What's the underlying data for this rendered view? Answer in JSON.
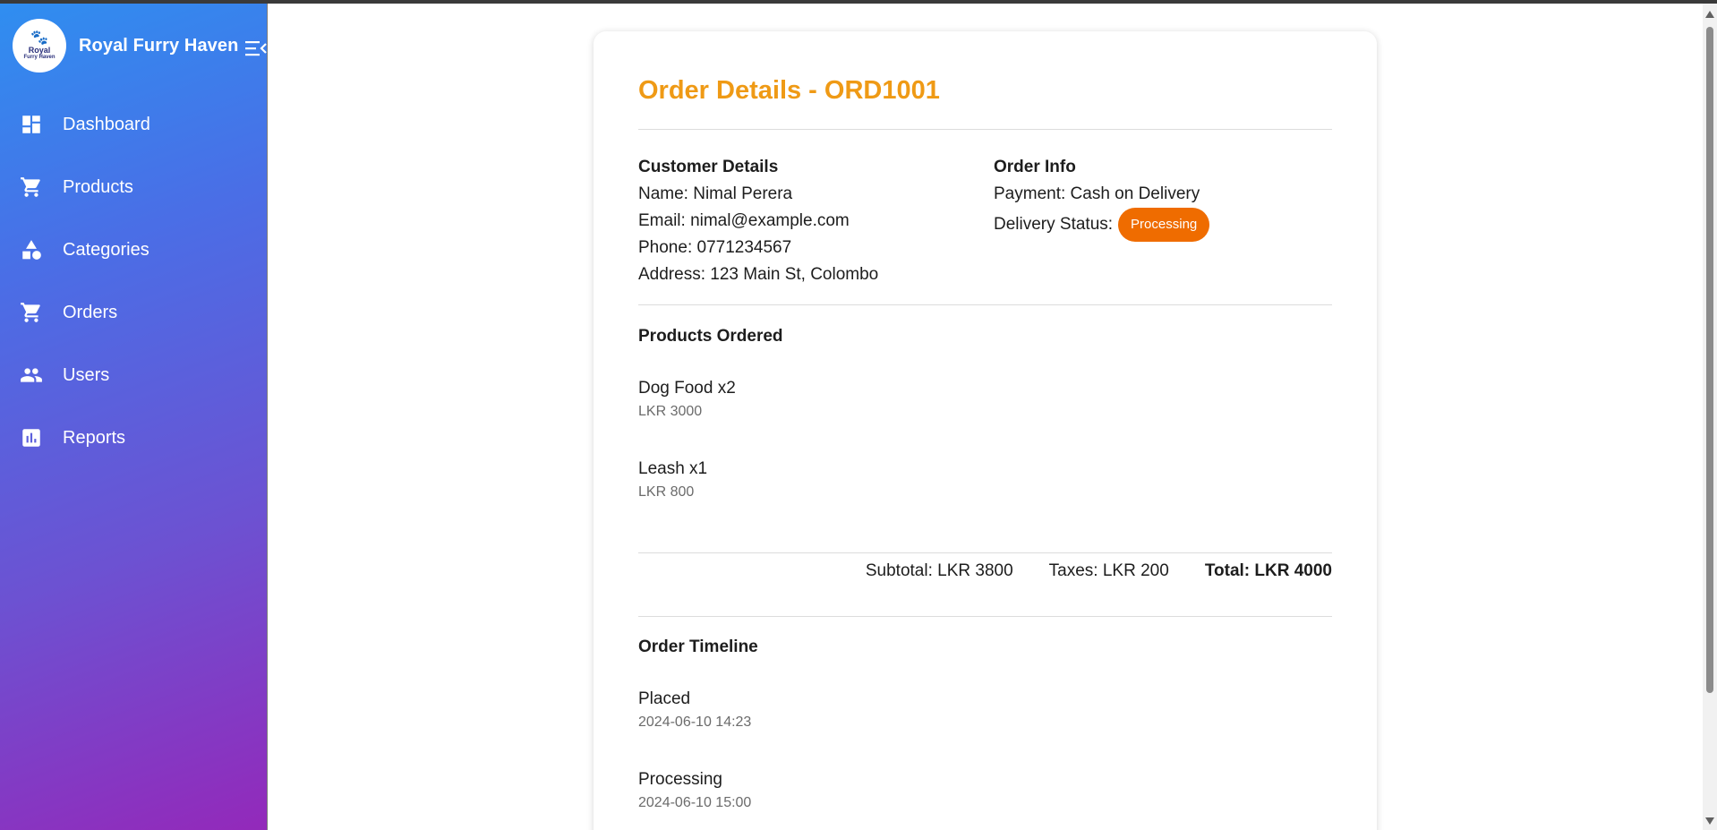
{
  "app": {
    "name": "Royal Furry Haven",
    "logo_line1": "Royal",
    "logo_line2": "Furry Haven"
  },
  "sidebar": {
    "items": [
      {
        "label": "Dashboard",
        "icon": "dashboard-icon"
      },
      {
        "label": "Products",
        "icon": "cart-icon"
      },
      {
        "label": "Categories",
        "icon": "category-icon"
      },
      {
        "label": "Orders",
        "icon": "cart-icon"
      },
      {
        "label": "Users",
        "icon": "people-icon"
      },
      {
        "label": "Reports",
        "icon": "bar-chart-icon"
      }
    ]
  },
  "order": {
    "title": "Order Details - ORD1001",
    "customer": {
      "heading": "Customer Details",
      "name": "Name: Nimal Perera",
      "email": "Email: nimal@example.com",
      "phone": "Phone: 0771234567",
      "address": "Address: 123 Main St, Colombo"
    },
    "info": {
      "heading": "Order Info",
      "payment": "Payment: Cash on Delivery",
      "delivery_label": "Delivery Status:",
      "delivery_status": "Processing"
    },
    "products": {
      "heading": "Products Ordered",
      "items": [
        {
          "name": "Dog Food x2",
          "price": "LKR 3000"
        },
        {
          "name": "Leash x1",
          "price": "LKR 800"
        }
      ]
    },
    "totals": {
      "subtotal": "Subtotal: LKR 3800",
      "taxes": "Taxes: LKR 200",
      "total": "Total: LKR 4000"
    },
    "timeline": {
      "heading": "Order Timeline",
      "events": [
        {
          "status": "Placed",
          "time": "2024-06-10 14:23"
        },
        {
          "status": "Processing",
          "time": "2024-06-10 15:00"
        }
      ]
    }
  },
  "colors": {
    "title_accent": "#ef9a15",
    "status_badge": "#ef6c00",
    "sidebar_gradient_start": "#2f8ef0",
    "sidebar_gradient_end": "#9329ba"
  }
}
